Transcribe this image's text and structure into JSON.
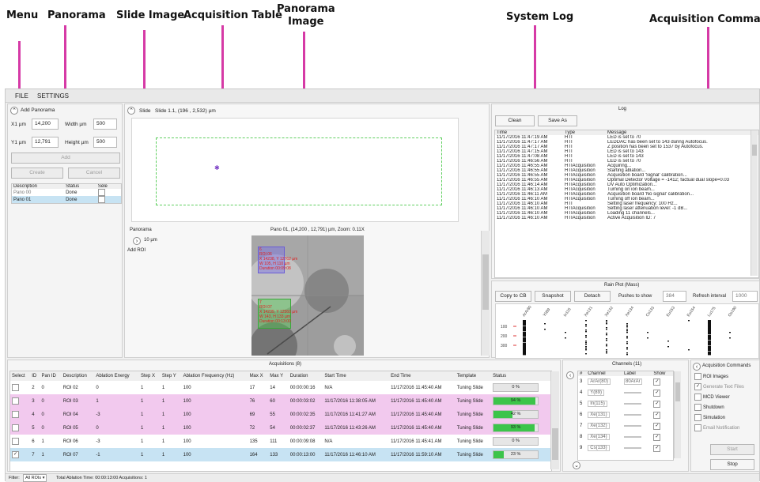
{
  "callouts": {
    "menu": "Menu",
    "panorama": "Panorama",
    "slide_image": "Slide Image",
    "acq_table": "Acquisition Table",
    "panorama_image_1": "Panorama",
    "panorama_image_2": "Image",
    "system_log": "System Log",
    "acq_commands": "Acquisition Commands"
  },
  "menu": {
    "file": "FILE",
    "settings": "SETTINGS"
  },
  "panorama_panel": {
    "add_panorama": "Add Panorama",
    "x1_label": "X1 µm",
    "x1_value": "14,200",
    "width_label": "Width µm",
    "width_value": "500",
    "y1_label": "Y1 µm",
    "y1_value": "12,791",
    "height_label": "Height µm",
    "height_value": "500",
    "add_btn": "Add",
    "create_btn": "Create",
    "cancel_btn": "Cancel",
    "headers": [
      "Description",
      "Status",
      "Sele"
    ],
    "rows": [
      {
        "desc": "Pano 00",
        "status": "Done"
      },
      {
        "desc": "Pano 01",
        "status": "Done"
      }
    ]
  },
  "slide": {
    "label": "Slide",
    "info": "Slide 1.1, (196 , 2,532) µm"
  },
  "pano_view": {
    "label": "Panorama",
    "scale": "10 µm",
    "add_roi": "Add ROI",
    "caption": "Pano 01, (14,200 , 12,791) µm, Zoom: 0.11X",
    "roi1": {
      "l1": "6",
      "l2": "ROI 06",
      "l3": "X 14238, Y 12762 µm",
      "l4": "W 105, H 110 µm",
      "l5": "Duration 00:09:08"
    },
    "roi2": {
      "l1": "7",
      "l2": "ROI 07",
      "l3": "X 14239, Y 12560 µm",
      "l4": "W 143, H 133 µm",
      "l5": "Duration 00:13:00"
    }
  },
  "log": {
    "title": "Log",
    "clean_btn": "Clean",
    "save_btn": "Save As",
    "headers": [
      "Time",
      "Type",
      "Message"
    ],
    "rows": [
      [
        "11/17/2016 11:47:19 AM",
        "HTI",
        "LED is set to 70"
      ],
      [
        "11/17/2016 11:47:17 AM",
        "HTI",
        "LEDDAC has been set to 143 during Autofocus."
      ],
      [
        "11/17/2016 11:47:17 AM",
        "HTI",
        "Z position has been set to 1537 by Autofocus."
      ],
      [
        "11/17/2016 11:47:15 AM",
        "HTI",
        "LED is set to 143"
      ],
      [
        "11/17/2016 11:47:08 AM",
        "HTI",
        "LED is set to 143"
      ],
      [
        "11/17/2016 11:46:56 AM",
        "HTI",
        "LED is set to 70"
      ],
      [
        "11/17/2016 11:46:55 AM",
        "HTIAcquisition",
        "Acquiring..."
      ],
      [
        "11/17/2016 11:46:55 AM",
        "HTIAcquisition",
        "Starting ablation..."
      ],
      [
        "11/17/2016 11:46:55 AM",
        "HTIAcquisition",
        "Acquisition board 'Signal' calibration..."
      ],
      [
        "11/17/2016 11:46:55 AM",
        "HTIAcquisition",
        "Optimal Detector Voltage = -1412; factual dual slope=0.03"
      ],
      [
        "11/17/2016 11:46:14 AM",
        "HTIAcquisition",
        "DV Auto Optimization..."
      ],
      [
        "11/17/2016 11:46:13 AM",
        "HTIAcquisition",
        "Turning on ion beam..."
      ],
      [
        "11/17/2016 11:46:11 AM",
        "HTIAcquisition",
        "Acquisition board 'No signal' calibration..."
      ],
      [
        "11/17/2016 11:46:10 AM",
        "HTIAcquisition",
        "Turning off ion beam..."
      ],
      [
        "11/17/2016 11:46:10 AM",
        "HTI",
        "Setting laser frequency: 100 Hz..."
      ],
      [
        "11/17/2016 11:46:10 AM",
        "HTIAcquisition",
        "Setting laser attenuation level: -1 dB..."
      ],
      [
        "11/17/2016 11:46:10 AM",
        "HTIAcquisition",
        "Loading 11 channels..."
      ],
      [
        "11/17/2016 11:46:10 AM",
        "HTIAcquisition",
        "Active Acquisition ID: 7"
      ]
    ]
  },
  "rain": {
    "title": "Rain Plot (Mass)",
    "copy_btn": "Copy to CB",
    "snapshot_btn": "Snapshot",
    "detach_btn": "Detach",
    "pushes_label": "Pushes to show",
    "pushes_value": "384",
    "refresh_label": "Refresh interval",
    "refresh_value": "1000",
    "channel_labels": [
      "ArAr80",
      "Y089",
      "In115",
      "Xe131",
      "Xe132",
      "Xe134",
      "Cs133",
      "Eu153",
      "Eu154",
      "Lu175",
      "Os190"
    ],
    "y_ticks": [
      "100",
      "200",
      "300"
    ]
  },
  "acquisitions": {
    "title": "Acquisitions (8)",
    "headers": [
      "Select",
      "ID",
      "Pan ID",
      "Description",
      "Ablation Energy",
      "Step X",
      "Step Y",
      "Ablation Frequency (Hz)",
      "Max X",
      "Max Y",
      "Duration",
      "Start Time",
      "End Time",
      "Template",
      "Status"
    ],
    "rows": [
      {
        "id": "2",
        "pan": "0",
        "desc": "ROI 02",
        "energy": "0",
        "sx": "1",
        "sy": "1",
        "freq": "100",
        "mx": "17",
        "my": "14",
        "dur": "00:00:00:16",
        "start": "N/A",
        "end": "11/17/2016 11:45:40 AM",
        "tpl": "Tuning Slide",
        "status": "0 %",
        "progress": 0
      },
      {
        "id": "3",
        "pan": "0",
        "desc": "ROI 03",
        "energy": "1",
        "sx": "1",
        "sy": "1",
        "freq": "100",
        "mx": "76",
        "my": "60",
        "dur": "00:00:03:02",
        "start": "11/17/2016 11:38:05 AM",
        "end": "11/17/2016 11:45:40 AM",
        "tpl": "Tuning Slide",
        "status": "94 %",
        "progress": 94
      },
      {
        "id": "4",
        "pan": "0",
        "desc": "ROI 04",
        "energy": "-3",
        "sx": "1",
        "sy": "1",
        "freq": "100",
        "mx": "69",
        "my": "55",
        "dur": "00:00:02:35",
        "start": "11/17/2016 11:41:27 AM",
        "end": "11/17/2016 11:45:40 AM",
        "tpl": "Tuning Slide",
        "status": "42 %",
        "progress": 42
      },
      {
        "id": "5",
        "pan": "0",
        "desc": "ROI 05",
        "energy": "0",
        "sx": "1",
        "sy": "1",
        "freq": "100",
        "mx": "72",
        "my": "54",
        "dur": "00:00:02:37",
        "start": "11/17/2016 11:43:26 AM",
        "end": "11/17/2016 11:45:40 AM",
        "tpl": "Tuning Slide",
        "status": "93 %",
        "progress": 93
      },
      {
        "id": "6",
        "pan": "1",
        "desc": "ROI 06",
        "energy": "-3",
        "sx": "1",
        "sy": "1",
        "freq": "100",
        "mx": "135",
        "my": "111",
        "dur": "00:00:09:08",
        "start": "N/A",
        "end": "11/17/2016 11:45:41 AM",
        "tpl": "Tuning Slide",
        "status": "0 %",
        "progress": 0
      },
      {
        "id": "7",
        "pan": "1",
        "desc": "ROI 07",
        "energy": "-1",
        "sx": "1",
        "sy": "1",
        "freq": "100",
        "mx": "164",
        "my": "133",
        "dur": "00:00:13:00",
        "start": "11/17/2016 11:46:10 AM",
        "end": "11/17/2016 11:59:10 AM",
        "tpl": "Tuning Slide",
        "status": "23 %",
        "progress": 23
      }
    ]
  },
  "channels": {
    "title": "Channels (11)",
    "headers": [
      "#",
      "Channel",
      "Label",
      "Show"
    ],
    "rows": [
      {
        "n": "3",
        "ch": "ArAr(80)",
        "label": "80ArAr"
      },
      {
        "n": "4",
        "ch": "Y(89)",
        "label": ""
      },
      {
        "n": "5",
        "ch": "In(115)",
        "label": ""
      },
      {
        "n": "6",
        "ch": "Xe(131)",
        "label": ""
      },
      {
        "n": "7",
        "ch": "Xe(132)",
        "label": ""
      },
      {
        "n": "8",
        "ch": "Xe(134)",
        "label": ""
      },
      {
        "n": "9",
        "ch": "Cs(133)",
        "label": ""
      }
    ]
  },
  "commands": {
    "title": "Acquisition Commands",
    "options": [
      "ROI Images",
      "Generate Text Files",
      "MCD Viewer",
      "Shutdown",
      "Simulation",
      "Email Notification"
    ],
    "start_btn": "Start",
    "stop_btn": "Stop"
  },
  "status_bar": {
    "filter_label": "Filter:",
    "filter_value": "All ROIs",
    "summary": "Total Ablation Time: 00:00:13:00  Acquisitions: 1"
  },
  "colors": {
    "accent": "#d63aa6",
    "row_pink": "#f2c9ee",
    "row_selected": "#c7e3f3",
    "progress_green": "#3cc44a"
  }
}
